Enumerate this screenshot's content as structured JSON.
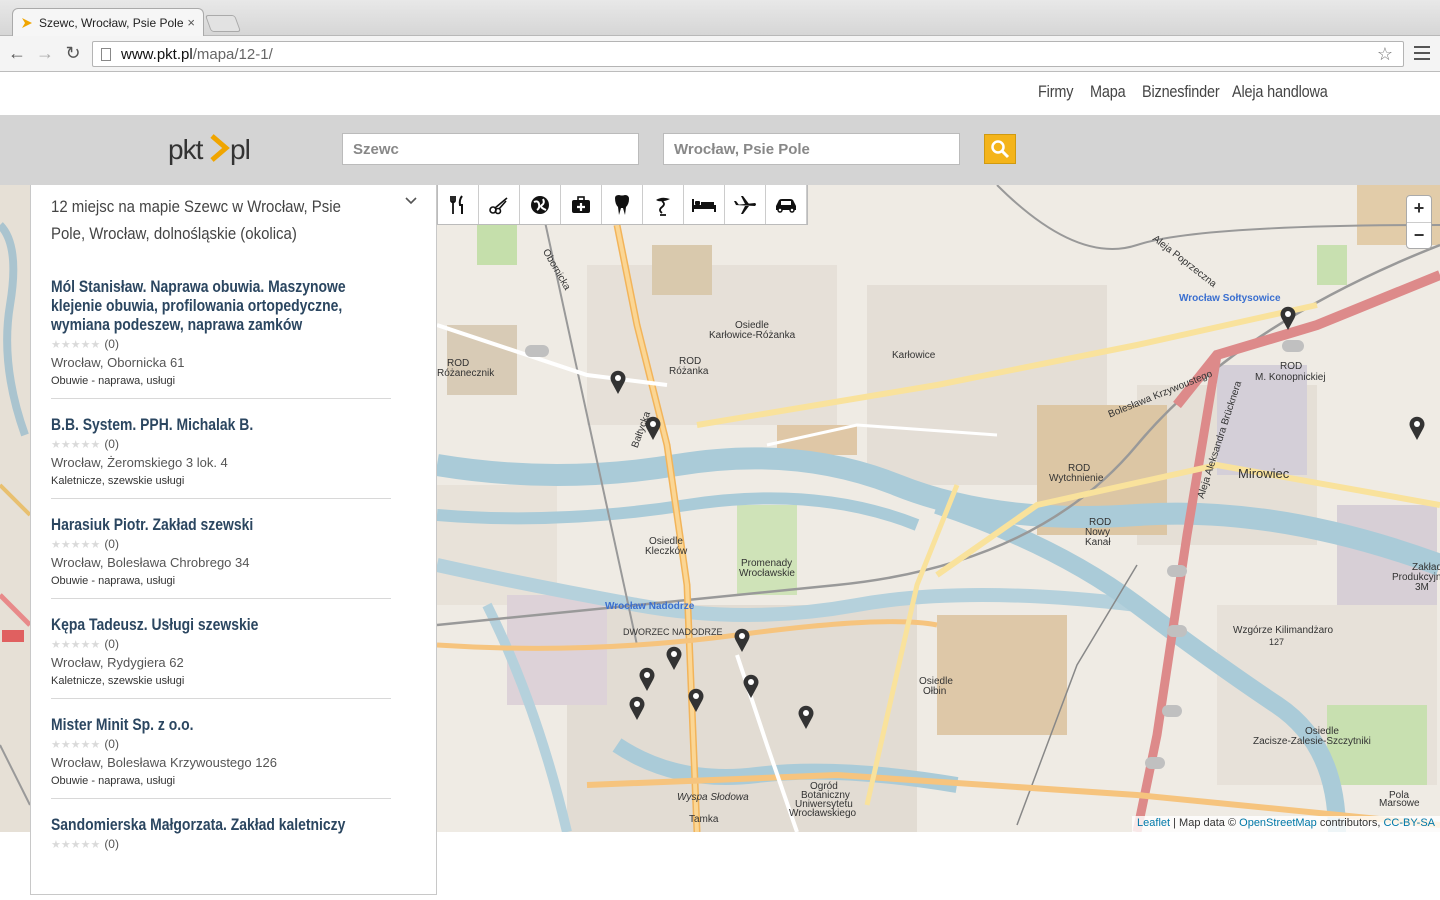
{
  "browser": {
    "tab_title": "Szewc, Wrocław, Psie Pole",
    "url_host": "www.pkt.pl",
    "url_path": "/mapa/12-1/"
  },
  "site_nav": {
    "items": [
      "Firmy",
      "Mapa",
      "Biznesfinder",
      "Aleja handlowa"
    ]
  },
  "search": {
    "what_value": "Szewc",
    "where_value": "Wrocław, Psie Pole"
  },
  "panel": {
    "heading": "12 miejsc na mapie Szewc w Wrocław, Psie Pole, Wrocław, dolnośląskie (okolica)",
    "results": [
      {
        "name": "Mól Stanisław. Naprawa obuwia. Maszynowe klejenie obuwia, profilowania ortopedyczne, wymiana podeszew, naprawa zamków",
        "rating": "(0)",
        "address": "Wrocław, Obornicka 61",
        "category": "Obuwie - naprawa, usługi"
      },
      {
        "name": "B.B. System. PPH. Michalak B.",
        "rating": "(0)",
        "address": "Wrocław, Żeromskiego 3 lok. 4",
        "category": "Kaletnicze, szewskie usługi"
      },
      {
        "name": "Harasiuk Piotr. Zakład szewski",
        "rating": "(0)",
        "address": "Wrocław, Bolesława Chrobrego 34",
        "category": "Obuwie - naprawa, usługi"
      },
      {
        "name": "Kępa Tadeusz. Usługi szewskie",
        "rating": "(0)",
        "address": "Wrocław, Rydygiera 62",
        "category": "Kaletnicze, szewskie usługi"
      },
      {
        "name": "Mister Minit Sp. z o.o.",
        "rating": "(0)",
        "address": "Wrocław, Bolesława Krzywoustego 126",
        "category": "Obuwie - naprawa, usługi"
      },
      {
        "name": "Sandomierska Małgorzata. Zakład kaletniczy",
        "rating": "(0)",
        "address": "",
        "category": ""
      }
    ]
  },
  "map": {
    "poi_icons": [
      "restaurant-icon",
      "scissors-icon",
      "globe-icon",
      "first-aid-icon",
      "tooth-icon",
      "pharmacy-icon",
      "bed-icon",
      "airplane-icon",
      "car-icon"
    ],
    "zoom_in": "+",
    "zoom_out": "−",
    "attribution_leaflet": "Leaflet",
    "attribution_text": " | Map data © ",
    "attribution_osm": "OpenStreetMap",
    "attribution_contrib": " contributors, ",
    "attribution_license": "CC-BY-SA",
    "labels": [
      {
        "t": "Osiedle",
        "cls": ""
      },
      {
        "t": "Karłowice-Różanka",
        "cls": ""
      },
      {
        "t": "Karłowice",
        "cls": ""
      },
      {
        "t": "ROD",
        "cls": ""
      },
      {
        "t": "Różanka",
        "cls": ""
      },
      {
        "t": "Wrocław Sołtysowice",
        "cls": "blue"
      },
      {
        "t": "ROD",
        "cls": ""
      },
      {
        "t": "M. Konopnickiej",
        "cls": ""
      },
      {
        "t": "Bolesława Krzywoustego",
        "cls": ""
      },
      {
        "t": "Aleja Poprzeczna",
        "cls": ""
      },
      {
        "t": "ROD",
        "cls": ""
      },
      {
        "t": "Wytchnienie",
        "cls": ""
      },
      {
        "t": "Mirowiec",
        "cls": ""
      },
      {
        "t": "ROD",
        "cls": ""
      },
      {
        "t": "Nowy",
        "cls": ""
      },
      {
        "t": "Kanał",
        "cls": ""
      },
      {
        "t": "Osiedle",
        "cls": ""
      },
      {
        "t": "Kleczków",
        "cls": ""
      },
      {
        "t": "Promenady",
        "cls": ""
      },
      {
        "t": "Wrocławskie",
        "cls": ""
      },
      {
        "t": "Wrocław Nadodrze",
        "cls": "blue"
      },
      {
        "t": "DWORZEC NADODRZE",
        "cls": ""
      },
      {
        "t": "Osiedle",
        "cls": ""
      },
      {
        "t": "Ołbin",
        "cls": ""
      },
      {
        "t": "Wzgórze Kilimandżaro",
        "cls": ""
      },
      {
        "t": "127",
        "cls": ""
      },
      {
        "t": "Zakład",
        "cls": ""
      },
      {
        "t": "Produkcyjny",
        "cls": ""
      },
      {
        "t": "3M",
        "cls": ""
      },
      {
        "t": "Osiedle",
        "cls": ""
      },
      {
        "t": "Zacisze-Zalesie-Szczytniki",
        "cls": ""
      },
      {
        "t": "Ogród",
        "cls": ""
      },
      {
        "t": "Botaniczny",
        "cls": ""
      },
      {
        "t": "Uniwersytetu",
        "cls": ""
      },
      {
        "t": "Wrocławskiego",
        "cls": ""
      },
      {
        "t": "Wyspa Słodowa",
        "cls": ""
      },
      {
        "t": "Tamka",
        "cls": ""
      },
      {
        "t": "Pola",
        "cls": ""
      },
      {
        "t": "Marsowe",
        "cls": ""
      },
      {
        "t": "Obornicka",
        "cls": ""
      },
      {
        "t": "Bałtycka",
        "cls": ""
      },
      {
        "t": "ROD",
        "cls": ""
      },
      {
        "t": "Różanecznik",
        "cls": ""
      },
      {
        "t": "Aleja Aleksandra Brücknera",
        "cls": ""
      }
    ],
    "marker_count": 11
  }
}
